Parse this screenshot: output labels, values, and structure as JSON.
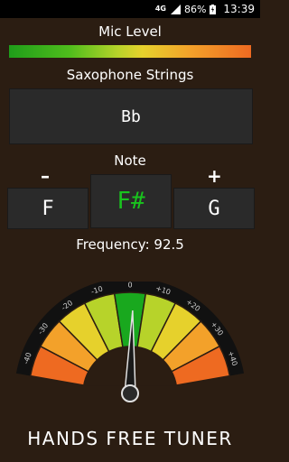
{
  "status": {
    "network": "4G",
    "battery": "86%",
    "time": "13:39"
  },
  "mic_level": {
    "title": "Mic Level"
  },
  "instrument": {
    "title": "Saxophone Strings",
    "value": "Bb"
  },
  "note": {
    "title": "Note",
    "minus": "–",
    "plus": "+",
    "prev": "F",
    "current": "F#",
    "next": "G"
  },
  "frequency": {
    "label": "Frequency: 92.5"
  },
  "gauge": {
    "ticks": [
      "-40",
      "-30",
      "-20",
      "-10",
      "0",
      "+10",
      "+20",
      "+30",
      "+40"
    ],
    "needle_cents": 1
  },
  "footer": {
    "title": "HANDS FREE TUNER"
  },
  "colors": {
    "background": "#2b1d12",
    "accent_note": "#19c31e",
    "gauge_segments": [
      "#ee6a21",
      "#f3a12a",
      "#e6d12c",
      "#b7d32a",
      "#19a81e",
      "#b7d32a",
      "#e6d12c",
      "#f3a12a",
      "#ee6a21"
    ]
  }
}
